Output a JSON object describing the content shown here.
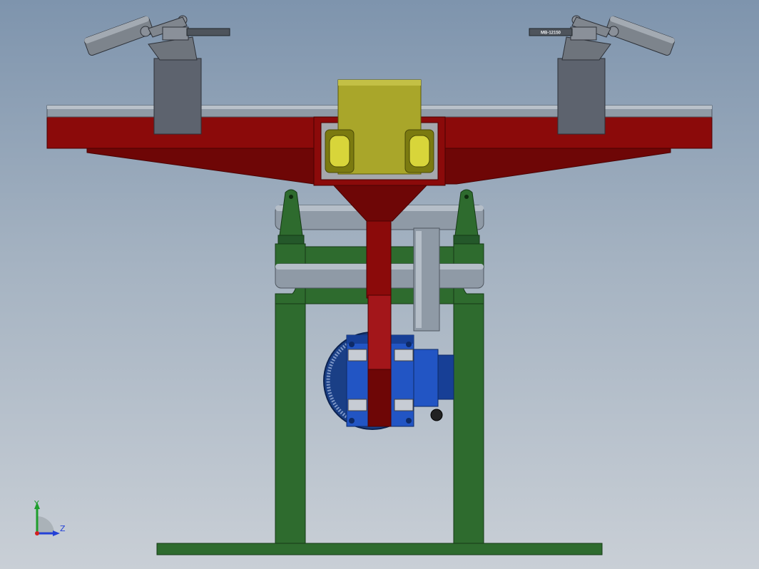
{
  "viewport": {
    "background_top": "#7e94ad",
    "background_bottom": "#c9cfd6"
  },
  "colors": {
    "red": "#8b0a0a",
    "red_dark": "#6e0606",
    "red_light": "#a3161a",
    "green": "#2e6b2e",
    "green_dark": "#1f4f1f",
    "yellow": "#a9a62a",
    "yellow_dark": "#7b7a10",
    "blue": "#2255c4",
    "blue_dark": "#173f96",
    "steel": "#8f9aa6",
    "steel_dark": "#5f6872",
    "block_grey": "#5d636e"
  },
  "triad": {
    "x_axis_color": "#d11f1f",
    "y_axis_color": "#1e9e2c",
    "z_axis_color": "#2441d6",
    "y_label": "Y",
    "z_label": "Z"
  },
  "clamps": [
    {
      "side": "left",
      "part_label": ""
    },
    {
      "side": "right",
      "part_label": "MB-12150"
    }
  ]
}
